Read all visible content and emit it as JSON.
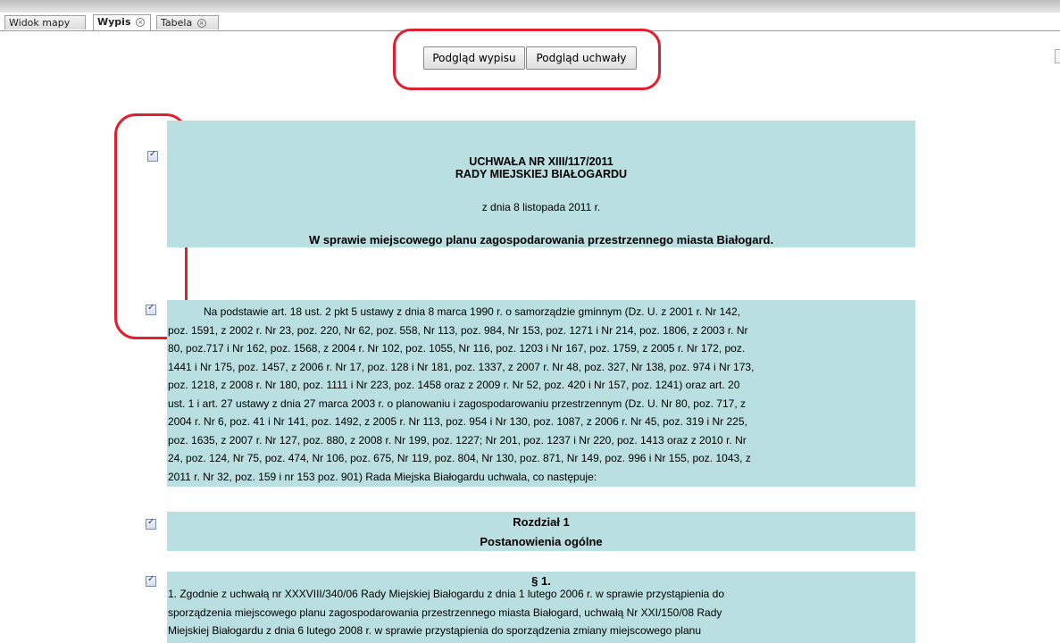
{
  "tabs": [
    {
      "label": "Widok mapy",
      "active": false,
      "closable": false
    },
    {
      "label": "Wypis",
      "active": true,
      "closable": true
    },
    {
      "label": "Tabela",
      "active": false,
      "closable": true
    }
  ],
  "toolbar": {
    "preview_extract_label": "Podgląd wypisu",
    "preview_resolution_label": "Podgląd uchwały"
  },
  "document": {
    "header": {
      "title_line1": "UCHWAŁA NR XIII/117/2011",
      "title_line2": "RADY MIEJSKIEJ BIAŁOGARDU",
      "date": "z dnia 8 listopada 2011 r.",
      "subject": "W sprawie miejscowego planu zagospodarowania przestrzennego miasta Białogard."
    },
    "preamble": {
      "lines": [
        "            Na podstawie art. 18 ust. 2 pkt 5 ustawy z dnia 8 marca 1990 r. o samorządzie gminnym (Dz. U. z 2001 r. Nr 142,",
        "poz. 1591, z 2002 r. Nr 23, poz. 220, Nr 62, poz. 558, Nr 113, poz. 984, Nr 153, poz. 1271 i Nr 214, poz. 1806, z 2003 r. Nr",
        "80, poz.717 i Nr 162, poz. 1568, z 2004 r. Nr 102, poz. 1055, Nr 116, poz. 1203 i Nr 167, poz. 1759, z 2005 r. Nr 172, poz.",
        "1441 i Nr 175, poz. 1457, z 2006 r. Nr 17, poz. 128 i Nr 181, poz. 1337, z 2007 r. Nr 48, poz. 327, Nr 138, poz. 974 i Nr 173,",
        "poz. 1218, z 2008 r. Nr 180, poz. 1111 i Nr 223, poz. 1458 oraz z 2009 r. Nr 52, poz. 420 i Nr 157, poz. 1241) oraz art. 20",
        "ust. 1 i art. 27 ustawy z dnia 27 marca 2003 r. o planowaniu i zagospodarowaniu przestrzennym (Dz. U. Nr 80, poz. 717, z",
        "2004 r. Nr 6, poz. 41 i Nr 141, poz. 1492, z 2005 r. Nr 113, poz. 954 i Nr 130, poz. 1087, z 2006 r. Nr 45, poz. 319 i Nr 225,",
        "poz. 1635, z 2007 r. Nr 127, poz. 880, z 2008 r. Nr 199, poz. 1227; Nr 201, poz. 1237 i Nr 220, poz. 1413 oraz z 2010 r. Nr",
        "24, poz. 124, Nr 75, poz. 474, Nr 106, poz. 675, Nr 119, poz. 804, Nr 130, poz. 871, Nr 149, poz. 996 i Nr 155, poz. 1043, z",
        "2011 r. Nr 32, poz. 159 i nr 153 poz. 901) Rada Miejska Białogardu uchwala, co następuje:"
      ]
    },
    "chapter": {
      "number_label": "Rozdział 1",
      "title": "Postanowienia ogólne"
    },
    "section1": {
      "heading": "§ 1.",
      "lines": [
        "1. Zgodnie z uchwałą nr XXXVIII/340/06 Rady Miejskiej Białogardu z dnia 1 lutego 2006 r. w sprawie przystąpienia do",
        "sporządzenia miejscowego planu zagospodarowania przestrzennego miasta Białogard, uchwałą Nr XXI/150/08 Rady",
        "Miejskiej Białogardu z dnia 6 lutego 2008 r. w sprawie przystąpienia do sporządzenia zmiany miejscowego planu"
      ]
    }
  },
  "colors": {
    "block_background": "#b9dfe0",
    "highlight_outline": "#e0202e"
  }
}
